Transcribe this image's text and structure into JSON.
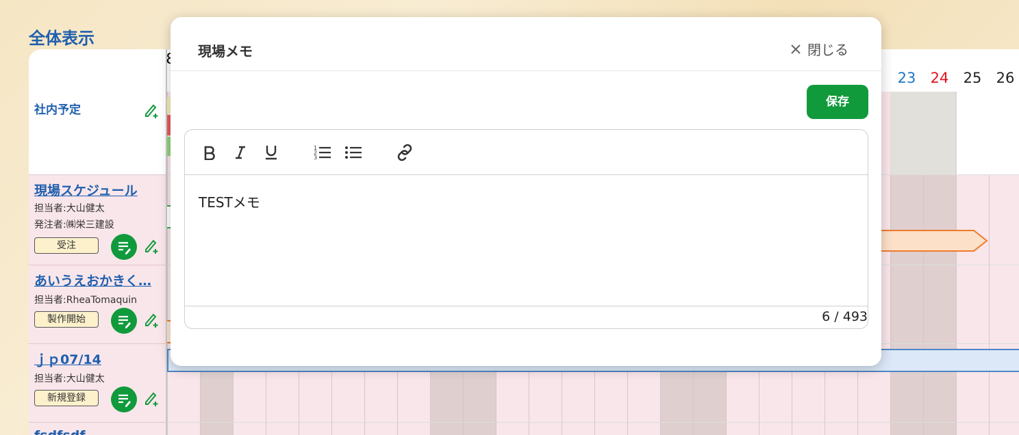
{
  "page": {
    "title": "全体表示"
  },
  "calendar": {
    "day_numbers": [
      {
        "label": "23",
        "color": "#1f77c4"
      },
      {
        "label": "24",
        "color": "#e0141e"
      },
      {
        "label": "25",
        "color": "#222222"
      },
      {
        "label": "26",
        "color": "#222222"
      }
    ],
    "partial_header_char": "8"
  },
  "rows": [
    {
      "type": "company",
      "title": "社内予定"
    },
    {
      "type": "project",
      "title": "現場スケジュール",
      "person": "担当者:大山健太",
      "orderer": "発注者:㈱栄三建設",
      "status": "受注"
    },
    {
      "type": "project",
      "title": "あいうえおかきく…",
      "person": "担当者:RheaTomaquin",
      "status": "製作開始"
    },
    {
      "type": "project",
      "title": "ｊｐ07/14",
      "person": "担当者:大山健太",
      "status": "新規登録"
    },
    {
      "type": "project",
      "title": "fsdfsdf"
    }
  ],
  "modal": {
    "title": "現場メモ",
    "close_label": "閉じる",
    "save_label": "保存",
    "content": "TESTメモ",
    "counter": "6 / 493",
    "toolbar": [
      "bold-icon",
      "italic-icon",
      "underline-icon",
      "ordered-list-icon",
      "bullet-list-icon",
      "link-icon"
    ]
  },
  "colors": {
    "accent": "#109a3c",
    "link": "#1f5fae",
    "row_bg": "#f9e6ea",
    "weekend": "#dfd0cf"
  }
}
